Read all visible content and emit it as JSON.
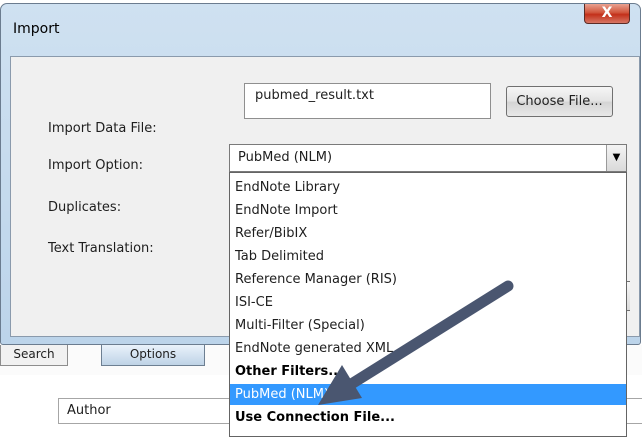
{
  "dialog": {
    "title": "Import",
    "close_label": "X",
    "fields": {
      "data_file_label": "Import Data File:",
      "data_file_value": "pubmed_result.txt",
      "choose_file_label": "Choose File...",
      "import_option_label": "Import Option:",
      "import_option_value": "PubMed (NLM)",
      "duplicates_label": "Duplicates:",
      "text_translation_label": "Text Translation:"
    },
    "dropdown_items": [
      "EndNote Library",
      "EndNote Import",
      "Refer/BibIX",
      "Tab Delimited",
      "Reference Manager (RIS)",
      "ISI-CE",
      "Multi-Filter (Special)",
      "EndNote generated XML",
      "Other Filters...",
      "PubMed (NLM)",
      "Use Connection File..."
    ],
    "selected_item": "PubMed (NLM)"
  },
  "background": {
    "tab_search": "Search",
    "tab_options": "Options",
    "author_field": "Author"
  },
  "colors": {
    "selection": "#3399ff",
    "close_button": "#c3301a",
    "annotation_arrow": "#4a5670"
  }
}
